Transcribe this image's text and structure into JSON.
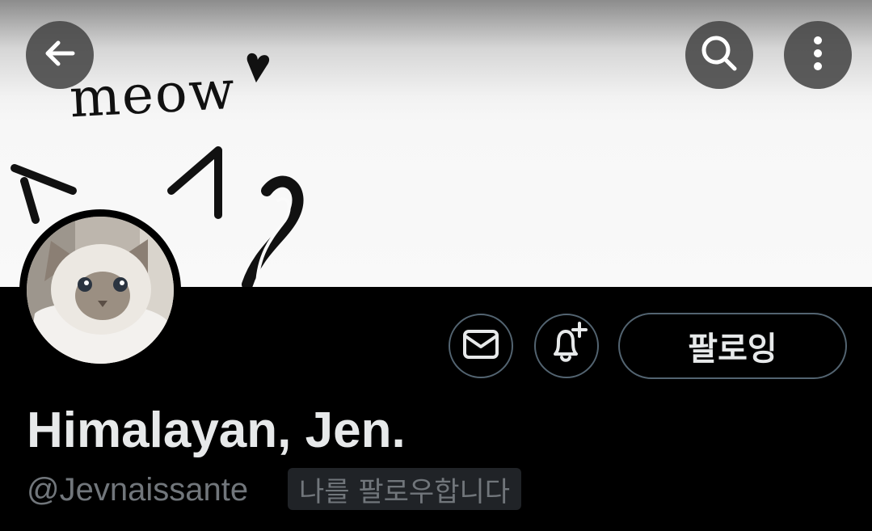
{
  "banner": {
    "doodle_text": "meow"
  },
  "top_bar": {
    "back_icon": "arrow-left-icon",
    "search_icon": "search-icon",
    "more_icon": "more-vertical-icon"
  },
  "profile": {
    "display_name": "Himalayan, Jen.",
    "handle": "@Jevnaissante",
    "follows_you_badge": "나를 팔로우합니다"
  },
  "actions": {
    "message_icon": "envelope-icon",
    "notify_icon": "bell-plus-icon",
    "follow_label": "팔로잉"
  },
  "colors": {
    "background": "#000000",
    "text_primary": "#e7e9ea",
    "text_secondary": "#71767b",
    "button_border": "#536471"
  }
}
